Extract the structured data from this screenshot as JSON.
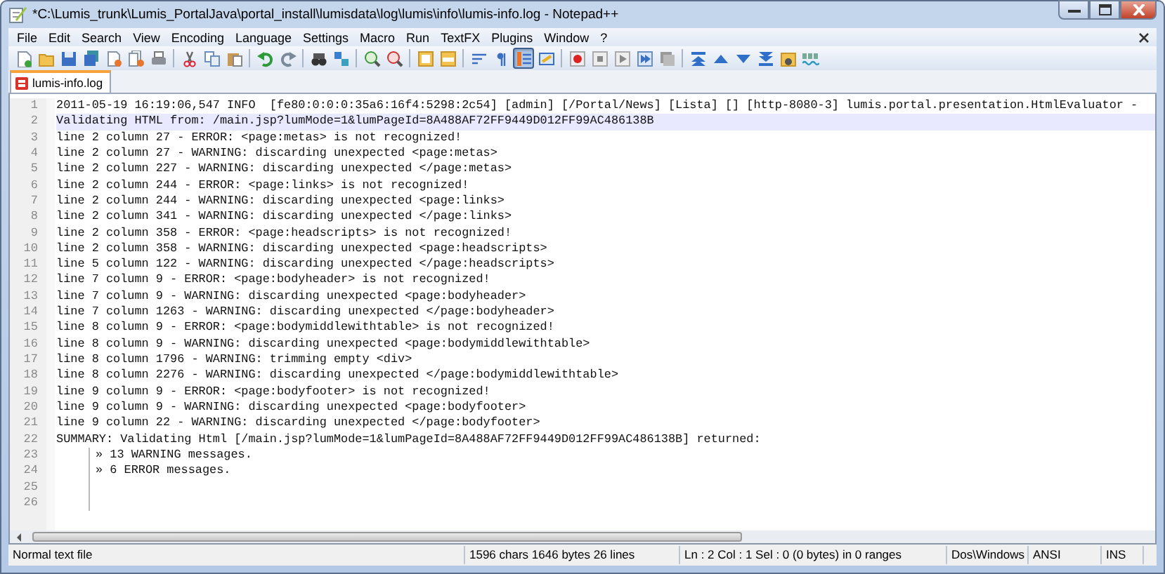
{
  "window": {
    "title": "*C:\\Lumis_trunk\\Lumis_PortalJava\\portal_install\\lumisdata\\log\\lumis\\info\\lumis-info.log - Notepad++"
  },
  "menu": [
    {
      "label": "File"
    },
    {
      "label": "Edit"
    },
    {
      "label": "Search"
    },
    {
      "label": "View"
    },
    {
      "label": "Encoding"
    },
    {
      "label": "Language"
    },
    {
      "label": "Settings"
    },
    {
      "label": "Macro"
    },
    {
      "label": "Run"
    },
    {
      "label": "TextFX"
    },
    {
      "label": "Plugins"
    },
    {
      "label": "Window"
    },
    {
      "label": "?"
    }
  ],
  "toolbar": [
    {
      "kind": "new",
      "pressed": false
    },
    {
      "kind": "open",
      "pressed": false
    },
    {
      "kind": "save",
      "pressed": false
    },
    {
      "kind": "saveall",
      "pressed": false
    },
    {
      "kind": "close",
      "pressed": false
    },
    {
      "kind": "closeall",
      "pressed": false
    },
    {
      "kind": "print",
      "pressed": false
    },
    {
      "kind": "sep"
    },
    {
      "kind": "cut",
      "pressed": false
    },
    {
      "kind": "copy",
      "pressed": false
    },
    {
      "kind": "paste",
      "pressed": false
    },
    {
      "kind": "sep"
    },
    {
      "kind": "undo",
      "pressed": false
    },
    {
      "kind": "redo",
      "pressed": false
    },
    {
      "kind": "sep"
    },
    {
      "kind": "find",
      "pressed": false
    },
    {
      "kind": "replace",
      "pressed": false
    },
    {
      "kind": "sep"
    },
    {
      "kind": "zoomin",
      "pressed": false
    },
    {
      "kind": "zoomout",
      "pressed": false
    },
    {
      "kind": "sep"
    },
    {
      "kind": "syncv",
      "pressed": false
    },
    {
      "kind": "synch",
      "pressed": false
    },
    {
      "kind": "sep"
    },
    {
      "kind": "wrap",
      "pressed": false
    },
    {
      "kind": "allchars",
      "pressed": false
    },
    {
      "kind": "indent",
      "pressed": true
    },
    {
      "kind": "panel",
      "pressed": false
    },
    {
      "kind": "sep"
    },
    {
      "kind": "record",
      "pressed": false
    },
    {
      "kind": "stop",
      "pressed": false
    },
    {
      "kind": "play",
      "pressed": false
    },
    {
      "kind": "playmulti",
      "pressed": false
    },
    {
      "kind": "savemacro",
      "pressed": false
    },
    {
      "kind": "sep"
    },
    {
      "kind": "first",
      "pressed": false
    },
    {
      "kind": "up",
      "pressed": false
    },
    {
      "kind": "down",
      "pressed": false
    },
    {
      "kind": "last",
      "pressed": false
    },
    {
      "kind": "image",
      "pressed": false
    },
    {
      "kind": "spell",
      "pressed": false
    }
  ],
  "tabs": [
    {
      "label": "lumis-info.log",
      "selected": true
    }
  ],
  "lines": [
    {
      "number": "1",
      "text": "2011-05-19 16:19:06,547 INFO  [fe80:0:0:0:35a6:16f4:5298:2c54] [admin] [/Portal/News] [Lista] [] [http-8080-3] lumis.portal.presentation.HtmlEvaluator -",
      "current": false,
      "indented": false
    },
    {
      "number": "2",
      "text": "Validating HTML from: /main.jsp?lumMode=1&lumPageId=8A488AF72FF9449D012FF99AC486138B",
      "current": true,
      "indented": false
    },
    {
      "number": "3",
      "text": "line 2 column 27 - ERROR: <page:metas> is not recognized!",
      "current": false,
      "indented": false
    },
    {
      "number": "4",
      "text": "line 2 column 27 - WARNING: discarding unexpected <page:metas>",
      "current": false,
      "indented": false
    },
    {
      "number": "5",
      "text": "line 2 column 227 - WARNING: discarding unexpected </page:metas>",
      "current": false,
      "indented": false
    },
    {
      "number": "6",
      "text": "line 2 column 244 - ERROR: <page:links> is not recognized!",
      "current": false,
      "indented": false
    },
    {
      "number": "7",
      "text": "line 2 column 244 - WARNING: discarding unexpected <page:links>",
      "current": false,
      "indented": false
    },
    {
      "number": "8",
      "text": "line 2 column 341 - WARNING: discarding unexpected </page:links>",
      "current": false,
      "indented": false
    },
    {
      "number": "9",
      "text": "line 2 column 358 - ERROR: <page:headscripts> is not recognized!",
      "current": false,
      "indented": false
    },
    {
      "number": "10",
      "text": "line 2 column 358 - WARNING: discarding unexpected <page:headscripts>",
      "current": false,
      "indented": false
    },
    {
      "number": "11",
      "text": "line 5 column 122 - WARNING: discarding unexpected </page:headscripts>",
      "current": false,
      "indented": false
    },
    {
      "number": "12",
      "text": "line 7 column 9 - ERROR: <page:bodyheader> is not recognized!",
      "current": false,
      "indented": false
    },
    {
      "number": "13",
      "text": "line 7 column 9 - WARNING: discarding unexpected <page:bodyheader>",
      "current": false,
      "indented": false
    },
    {
      "number": "14",
      "text": "line 7 column 1263 - WARNING: discarding unexpected </page:bodyheader>",
      "current": false,
      "indented": false
    },
    {
      "number": "15",
      "text": "line 8 column 9 - ERROR: <page:bodymiddlewithtable> is not recognized!",
      "current": false,
      "indented": false
    },
    {
      "number": "16",
      "text": "line 8 column 9 - WARNING: discarding unexpected <page:bodymiddlewithtable>",
      "current": false,
      "indented": false
    },
    {
      "number": "17",
      "text": "line 8 column 1796 - WARNING: trimming empty <div>",
      "current": false,
      "indented": false
    },
    {
      "number": "18",
      "text": "line 8 column 2276 - WARNING: discarding unexpected </page:bodymiddlewithtable>",
      "current": false,
      "indented": false
    },
    {
      "number": "19",
      "text": "line 9 column 9 - ERROR: <page:bodyfooter> is not recognized!",
      "current": false,
      "indented": false
    },
    {
      "number": "20",
      "text": "line 9 column 9 - WARNING: discarding unexpected <page:bodyfooter>",
      "current": false,
      "indented": false
    },
    {
      "number": "21",
      "text": "line 9 column 22 - WARNING: discarding unexpected </page:bodyfooter>",
      "current": false,
      "indented": false
    },
    {
      "number": "22",
      "text": "SUMMARY: Validating Html [/main.jsp?lumMode=1&lumPageId=8A488AF72FF9449D012FF99AC486138B] returned:",
      "current": false,
      "indented": false
    },
    {
      "number": "23",
      "text": "» 13 WARNING messages.",
      "current": false,
      "indented": true
    },
    {
      "number": "24",
      "text": "» 6 ERROR messages.",
      "current": false,
      "indented": true
    },
    {
      "number": "25",
      "current": false,
      "indented": true
    },
    {
      "number": "26",
      "current": false,
      "indented": true
    }
  ],
  "status_bar": [
    {
      "kind": "filetype",
      "text": "Normal text file"
    },
    {
      "kind": "stats",
      "text": "1596 chars  1646 bytes  26 lines"
    },
    {
      "kind": "position",
      "text": "Ln : 2    Col : 1    Sel : 0 (0 bytes) in 0 ranges"
    },
    {
      "kind": "eol",
      "text": "Dos\\Windows"
    },
    {
      "kind": "encoding",
      "text": "ANSI"
    },
    {
      "kind": "mode",
      "text": "INS"
    }
  ]
}
